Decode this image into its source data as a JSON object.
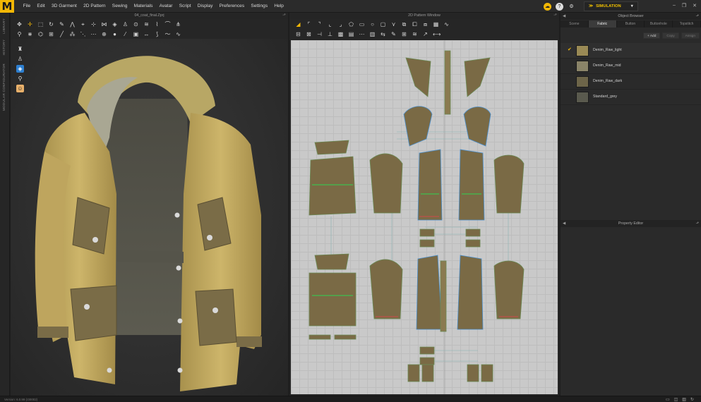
{
  "app": {
    "logo": "M"
  },
  "menu": [
    "File",
    "Edit",
    "3D Garment",
    "2D Pattern",
    "Sewing",
    "Materials",
    "Avatar",
    "Script",
    "Display",
    "Preferences",
    "Settings",
    "Help"
  ],
  "header_right": {
    "simulation_label": "SIMULATION",
    "help_glyph": "?"
  },
  "left_rail": {
    "labels": [
      "LIBRARY",
      "HISTORY",
      "MODULAR CONFIGURATOR"
    ]
  },
  "window_3d": {
    "title": "04_coat_final.Zprj"
  },
  "window_2d": {
    "title": "2D Pattern Window"
  },
  "object_browser": {
    "title": "Object Browser",
    "tabs": [
      "Scene",
      "Fabric",
      "Button",
      "Buttonhole",
      "Topstitch"
    ],
    "active_tab": "Fabric",
    "actions": [
      "+ Add",
      "Copy",
      "Assign"
    ],
    "fabrics": [
      {
        "name": "Denim_Raw_light",
        "color": "#9a8a55",
        "selected": true
      },
      {
        "name": "Denim_Raw_mid",
        "color": "#8a8468",
        "selected": false
      },
      {
        "name": "Denim_Raw_dark",
        "color": "#6d6549",
        "selected": false
      },
      {
        "name": "Standard_grey",
        "color": "#5a5a4e",
        "selected": false
      }
    ]
  },
  "property_editor": {
    "title": "Property Editor"
  },
  "status": {
    "version": "Version: 6.0.99 (r30002)"
  },
  "colors": {
    "accent": "#f2b705",
    "fabric_main": "#c4aa5c",
    "fabric_pocket": "#7a6c47",
    "pattern_piece": "#7a6a45"
  }
}
